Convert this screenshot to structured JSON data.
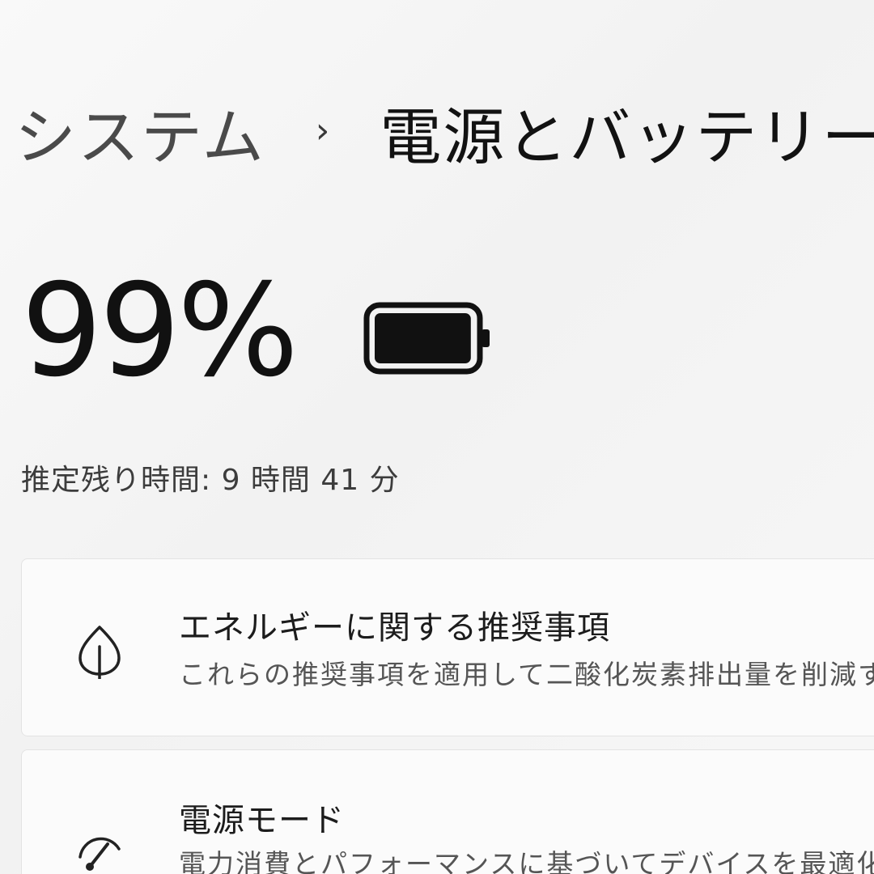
{
  "breadcrumb": {
    "parent": "システム",
    "separator": "›",
    "current": "電源とバッテリー"
  },
  "battery": {
    "percent_label": "99%",
    "level_percent": 99,
    "icon": "battery-icon",
    "remaining_label": "推定残り時間: 9 時間 41 分"
  },
  "cards": {
    "energy": {
      "icon": "leaf-icon",
      "title": "エネルギーに関する推奨事項",
      "description": "これらの推奨事項を適用して二酸化炭素排出量を削減す"
    },
    "power_mode": {
      "icon": "speedometer-icon",
      "title": "電源モード",
      "description": "電力消費とパフォーマンスに基づいてデバイスを最適化"
    }
  }
}
